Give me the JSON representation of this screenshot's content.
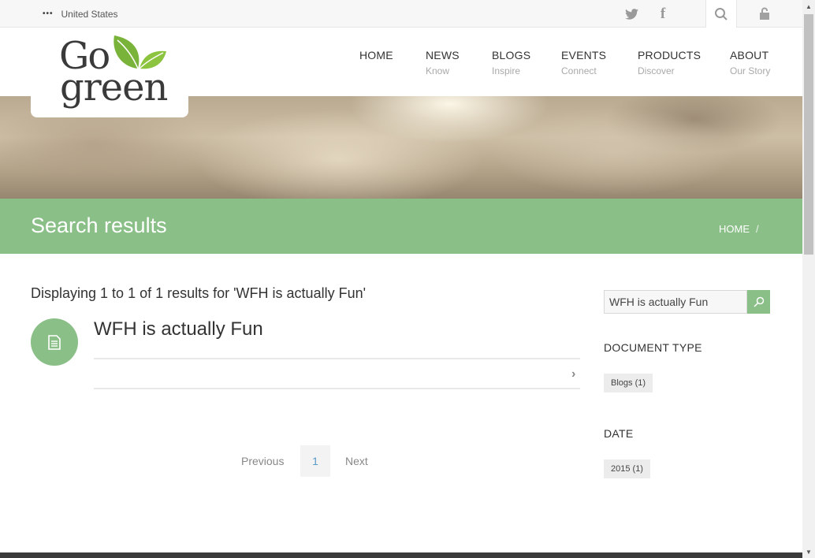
{
  "topbar": {
    "region_menu_icon": "more-dots-icon",
    "region": "United States",
    "icons": [
      "twitter-icon",
      "facebook-icon",
      "search-icon",
      "lock-icon"
    ]
  },
  "logo": {
    "line1": "Go",
    "line2": "green"
  },
  "nav": [
    {
      "label": "HOME",
      "sub": ""
    },
    {
      "label": "NEWS",
      "sub": "Know"
    },
    {
      "label": "BLOGS",
      "sub": "Inspire"
    },
    {
      "label": "EVENTS",
      "sub": "Connect"
    },
    {
      "label": "PRODUCTS",
      "sub": "Discover"
    },
    {
      "label": "ABOUT",
      "sub": "Our Story"
    }
  ],
  "page": {
    "title": "Search results",
    "breadcrumb": {
      "home": "HOME",
      "separator": "/"
    }
  },
  "results": {
    "summary": "Displaying 1 to 1 of 1 results for 'WFH is actually Fun'",
    "items": [
      {
        "title": "WFH is actually Fun",
        "icon": "document-icon"
      }
    ],
    "pagination": {
      "previous": "Previous",
      "current": "1",
      "next": "Next"
    }
  },
  "sidebar": {
    "search_value": "WFH is actually Fun",
    "facets": [
      {
        "heading": "DOCUMENT TYPE",
        "tags": [
          "Blogs (1)"
        ]
      },
      {
        "heading": "DATE",
        "tags": [
          "2015 (1)"
        ]
      }
    ]
  },
  "colors": {
    "accent": "#8abf87",
    "link": "#5a9bc8"
  }
}
